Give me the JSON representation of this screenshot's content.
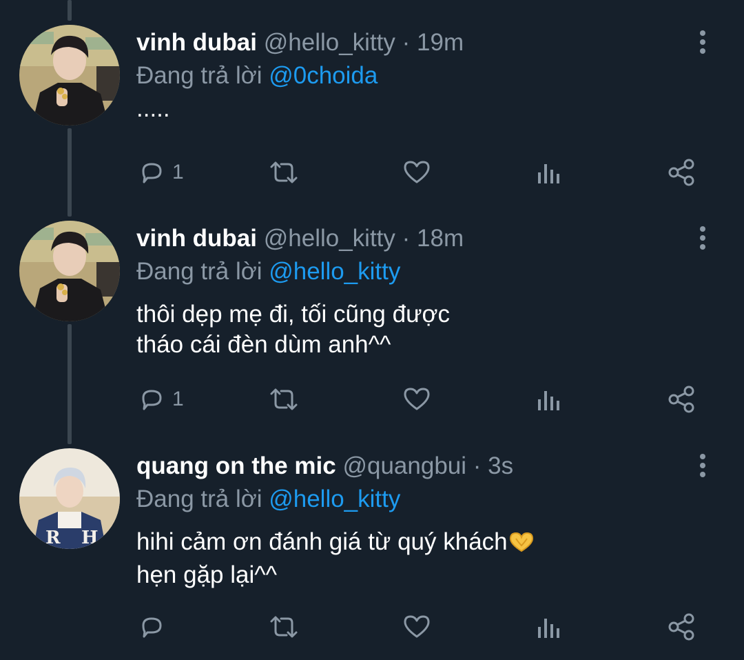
{
  "tweets": [
    {
      "name": "vinh dubai",
      "handle": "@hello_kitty",
      "separator": "·",
      "time": "19m",
      "reply_prefix": "Đang trả lời",
      "reply_to": "@0choida",
      "body_lines": [
        ".....",
        ""
      ],
      "reply_count": "1",
      "avatar": "avatar-vinh-dubai"
    },
    {
      "name": "vinh dubai",
      "handle": "@hello_kitty",
      "separator": "·",
      "time": "18m",
      "reply_prefix": "Đang trả lời",
      "reply_to": "@hello_kitty",
      "body_lines": [
        "thôi dẹp mẹ đi, tối cũng được",
        "tháo cái đèn dùm anh^^"
      ],
      "reply_count": "1",
      "avatar": "avatar-vinh-dubai"
    },
    {
      "name": "quang on the mic",
      "handle": "@quangbui",
      "separator": "·",
      "time": "3s",
      "reply_prefix": "Đang trả lời",
      "reply_to": "@hello_kitty",
      "body_lines": [
        "hihi cảm ơn đánh giá từ quý khách",
        "hẹn gặp lại^^"
      ],
      "reply_count": "",
      "avatar": "avatar-quang",
      "body_emoji": "heart-hands-icon"
    }
  ],
  "icons": {
    "reply": "reply-icon",
    "retweet": "retweet-icon",
    "like": "heart-icon",
    "analytics": "analytics-icon",
    "share": "share-icon",
    "more": "more-vertical-icon"
  },
  "colors": {
    "background": "#16202b",
    "text": "#ffffff",
    "muted": "#8b98a5",
    "link": "#1d9bf0",
    "thread_line": "#3b4650"
  }
}
